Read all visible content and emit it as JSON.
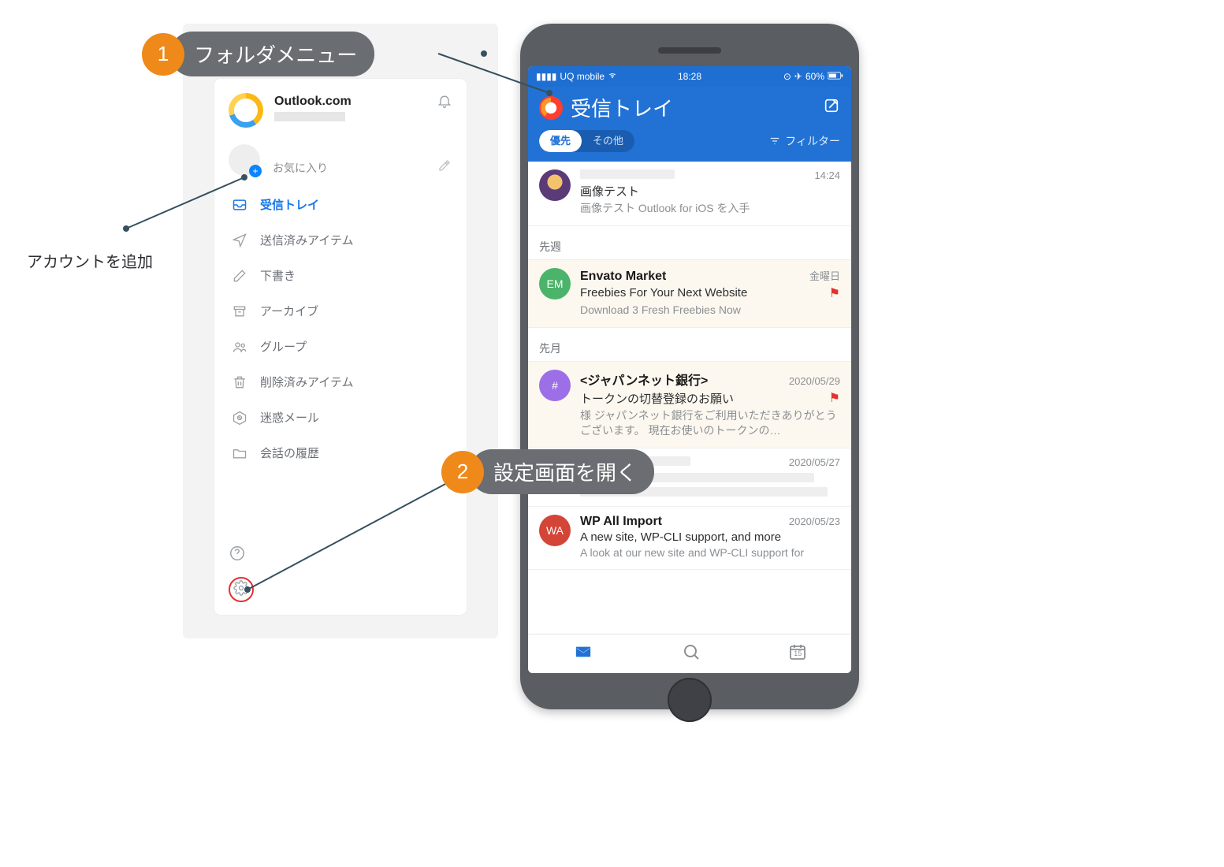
{
  "annotations": {
    "callout1_num": "1",
    "callout1_label": "フォルダメニュー",
    "callout2_num": "2",
    "callout2_label": "設定画面を開く",
    "add_account_label": "アカウントを追加"
  },
  "sidebar": {
    "account_name": "Outlook.com",
    "favorites_label": "お気に入り",
    "folders": [
      {
        "label": "受信トレイ",
        "selected": true
      },
      {
        "label": "送信済みアイテム",
        "selected": false
      },
      {
        "label": "下書き",
        "selected": false
      },
      {
        "label": "アーカイブ",
        "selected": false
      },
      {
        "label": "グループ",
        "selected": false
      },
      {
        "label": "削除済みアイテム",
        "selected": false
      },
      {
        "label": "迷惑メール",
        "selected": false
      },
      {
        "label": "会話の履歴",
        "selected": false
      }
    ]
  },
  "phone": {
    "status": {
      "carrier": "UQ mobile",
      "time": "18:28",
      "battery": "60%"
    },
    "inbox_title": "受信トレイ",
    "tabs": {
      "focused": "優先",
      "other": "その他"
    },
    "filter_label": "フィルター",
    "sections": {
      "last_week": "先週",
      "last_month": "先月"
    },
    "messages": [
      {
        "sender_redacted": true,
        "time": "14:24",
        "subject": "画像テスト",
        "preview": "画像テスト Outlook for iOS を入手",
        "avatar": "img"
      },
      {
        "sender": "Envato Market",
        "time": "金曜日",
        "subject": "Freebies For Your Next Website",
        "preview": "Download 3 Fresh Freebies Now",
        "avatar": "EM",
        "flag": true,
        "unread": true
      },
      {
        "sender": "<ジャパンネット銀行>",
        "time": "2020/05/29",
        "subject": "トークンの切替登録のお願い",
        "preview": "様 ジャパンネット銀行をご利用いただきありがとうございます。 現在お使いのトークンの…",
        "avatar": "#",
        "flag": true,
        "unread": true
      },
      {
        "sender_redacted": true,
        "time": "2020/05/27",
        "avatar_redacted": true
      },
      {
        "sender": "WP All Import",
        "time": "2020/05/23",
        "subject": "A new site, WP-CLI support, and more",
        "preview": "A look at our new site and WP-CLI support for",
        "avatar": "WA"
      }
    ],
    "bottom_cal_day": "15"
  }
}
